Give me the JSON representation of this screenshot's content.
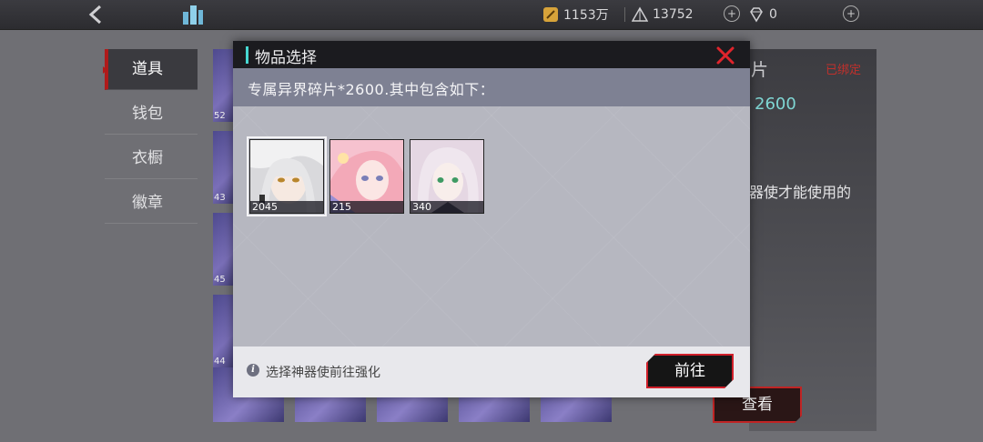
{
  "topbar": {
    "resources": [
      {
        "name": "gold",
        "icon": "coin-icon",
        "value": "1153万"
      },
      {
        "name": "crystal",
        "icon": "pyramid-icon",
        "value": "13752"
      },
      {
        "name": "diamond",
        "icon": "diamond-icon",
        "value": "0"
      }
    ]
  },
  "menu": {
    "items": [
      {
        "label": "道具",
        "active": true
      },
      {
        "label": "钱包",
        "active": false
      },
      {
        "label": "衣橱",
        "active": false
      },
      {
        "label": "徽章",
        "active": false
      }
    ]
  },
  "grid": {
    "counts": [
      "52",
      "43",
      "45",
      "44",
      ""
    ]
  },
  "right_panel": {
    "title": "片",
    "bound_label": "已绑定",
    "count": "2600",
    "description": "器使才能使用的",
    "view_button": "查看"
  },
  "dialog": {
    "title": "物品选择",
    "subtitle": "专属异界碎片*2600.其中包含如下：",
    "items": [
      {
        "count": "2045",
        "selected": true,
        "palette": [
          "#e9e9ea",
          "#cfcfd2",
          "#8a8a90"
        ]
      },
      {
        "count": "215",
        "selected": false,
        "palette": [
          "#f7b7c5",
          "#f39aa8",
          "#a29ad6"
        ]
      },
      {
        "count": "340",
        "selected": false,
        "palette": [
          "#ecdde8",
          "#d9c6e4",
          "#5d5768"
        ]
      }
    ],
    "hint": "选择神器使前往强化",
    "go_button": "前往"
  },
  "colors": {
    "accent_teal": "#46d8d2",
    "accent_red": "#d01f2a"
  }
}
